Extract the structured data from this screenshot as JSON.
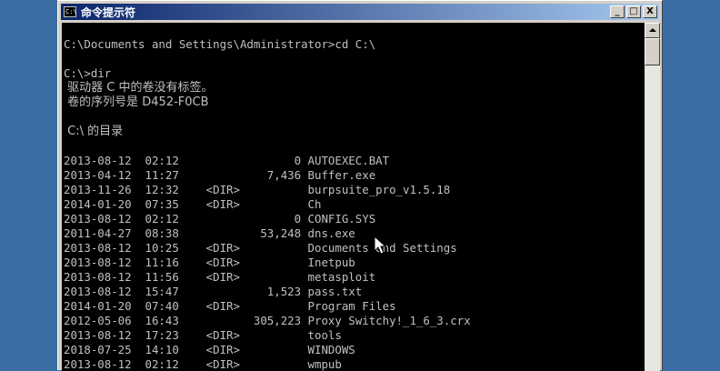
{
  "window": {
    "title": "命令提示符",
    "icon": "C:\\",
    "controls": {
      "minimize": "_",
      "maximize": "□",
      "close": "X"
    }
  },
  "console": {
    "lines": [
      "",
      "C:\\Documents and Settings\\Administrator>cd C:\\",
      "",
      "C:\\>dir",
      " 驱动器 C 中的卷没有标签。",
      " 卷的序列号是 D452-F0CB",
      "",
      " C:\\ 的目录",
      "",
      "2013-08-12  02:12                 0 AUTOEXEC.BAT",
      "2013-04-12  11:27             7,436 Buffer.exe",
      "2013-11-26  12:32    <DIR>          burpsuite_pro_v1.5.18",
      "2014-01-20  07:35    <DIR>          Ch",
      "2013-08-12  02:12                 0 CONFIG.SYS",
      "2011-04-27  08:38            53,248 dns.exe",
      "2013-08-12  10:25    <DIR>          Documents and Settings",
      "2013-08-12  11:16    <DIR>          Inetpub",
      "2013-08-12  11:56    <DIR>          metasploit",
      "2013-08-12  15:47             1,523 pass.txt",
      "2014-01-20  07:40    <DIR>          Program Files",
      "2012-05-06  16:43           305,223 Proxy Switchy!_1_6_3.crx",
      "2013-08-12  17:23    <DIR>          tools",
      "2018-07-25  14:10    <DIR>          WINDOWS",
      "2013-08-12  02:12    <DIR>          wmpub"
    ]
  },
  "colors": {
    "background": "#000000",
    "text": "#c0c0c0",
    "titlebar": "#0a246a",
    "desktop": "#3a6ea5"
  }
}
